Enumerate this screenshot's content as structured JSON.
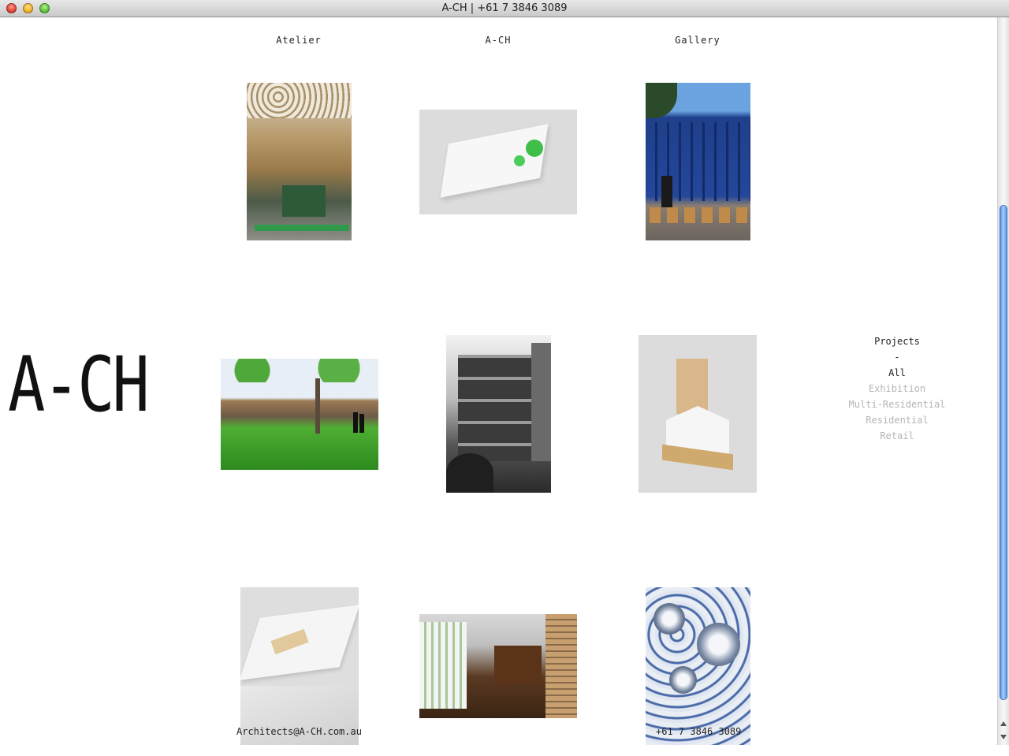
{
  "window": {
    "title": "A-CH | +61 7 3846 3089"
  },
  "nav": {
    "atelier": "Atelier",
    "ach": "A-CH",
    "gallery": "Gallery"
  },
  "logo": "A-CH",
  "filters": {
    "heading": "Projects",
    "separator": "-",
    "items": [
      "All",
      "Exhibition",
      "Multi-Residential",
      "Residential",
      "Retail"
    ]
  },
  "footer": {
    "email": "Architects@A-CH.com.au",
    "phone": "+61 7 3846 3089"
  },
  "colors": {
    "text": "#222222",
    "inactive_filter": "#b5b5b5",
    "scroll_thumb": "#5a98ea"
  }
}
